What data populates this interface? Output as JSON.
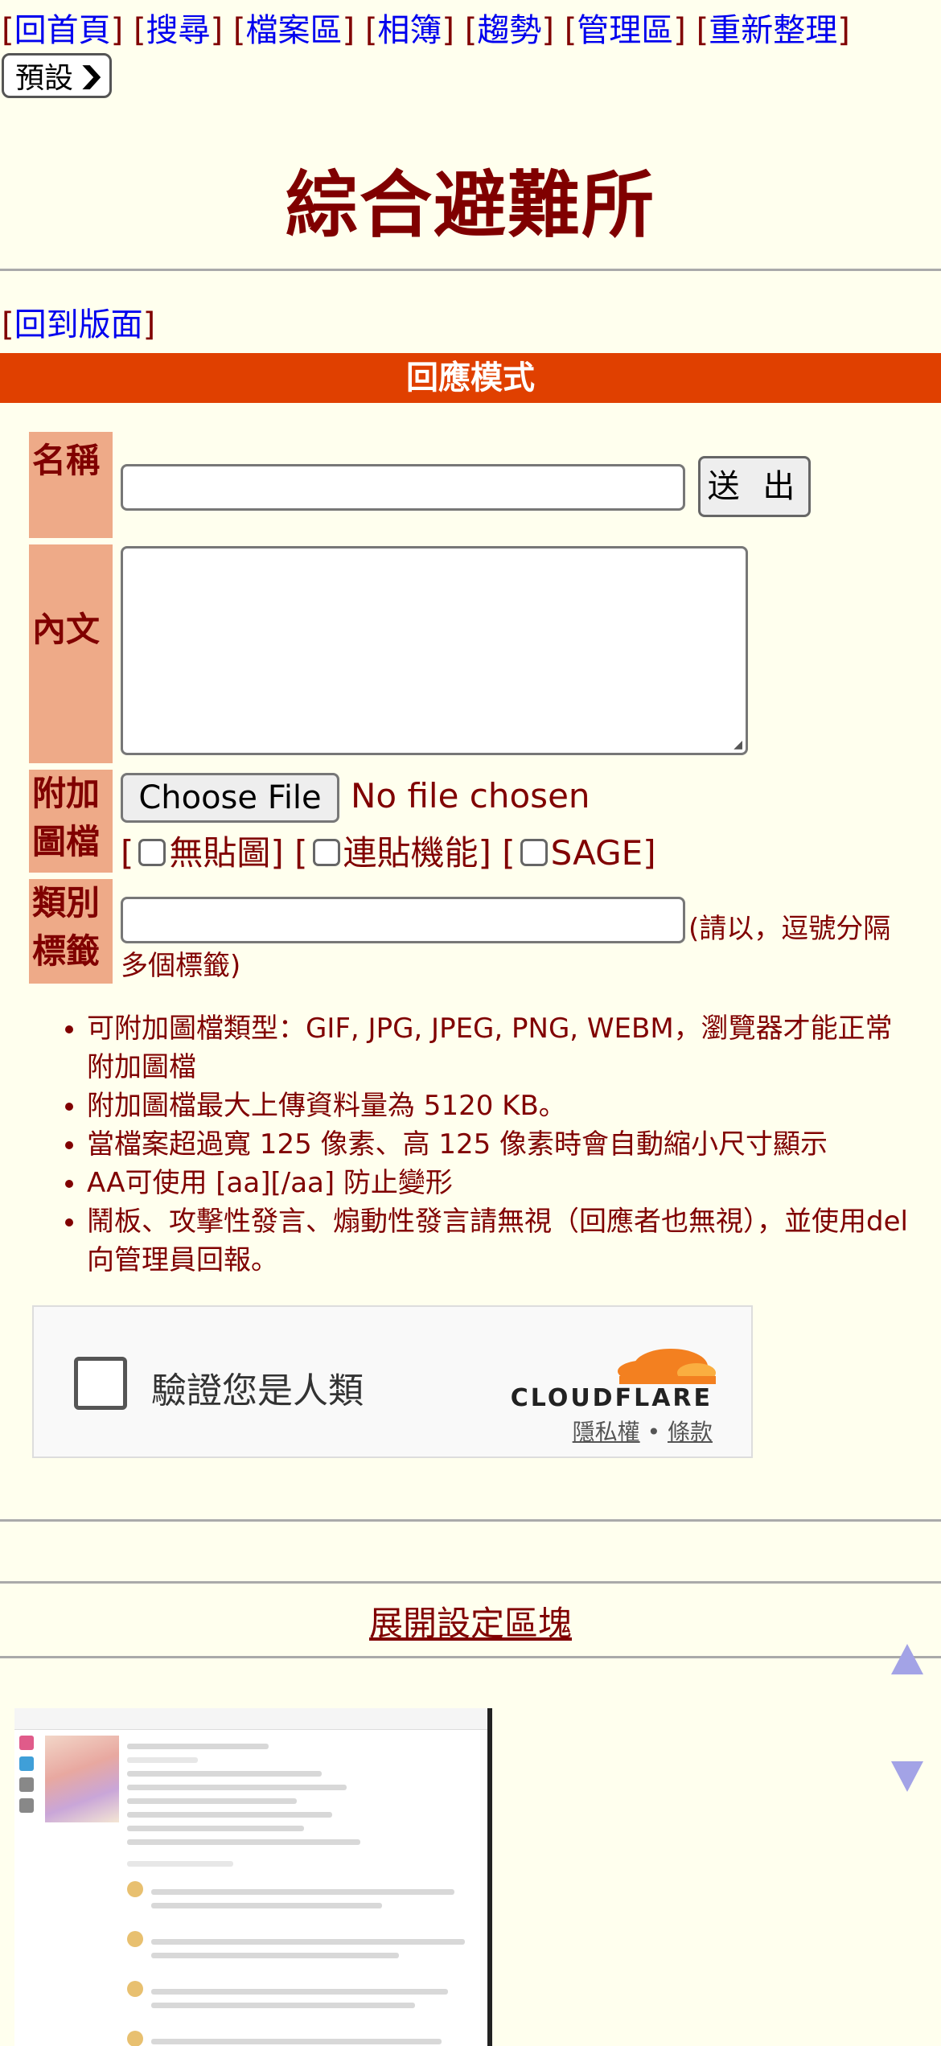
{
  "nav": {
    "links": [
      "回首頁",
      "搜尋",
      "檔案區",
      "相簿",
      "趨勢",
      "管理區",
      "重新整理"
    ],
    "style_select": "預設"
  },
  "board": {
    "title": "綜合避難所",
    "back_link": "回到版面",
    "mode_label": "回應模式"
  },
  "form": {
    "name_label": "名稱",
    "submit_label": "送 出",
    "body_label": "內文",
    "file_label": "附加圖檔",
    "choose_file_label": "Choose File",
    "no_file_text": "No file chosen",
    "options": [
      "無貼圖",
      "連貼機能",
      "SAGE"
    ],
    "category_label": "類別標籤",
    "category_hint_1": "(請以，逗號分隔",
    "category_hint_2": "多個標籤)"
  },
  "notes": [
    "可附加圖檔類型：GIF, JPG, JPEG, PNG, WEBM，瀏覽器才能正常附加圖檔",
    "附加圖檔最大上傳資料量為 5120 KB。",
    "當檔案超過寬 125 像素、高 125 像素時會自動縮小尺寸顯示",
    "AA可使用 [aa][/aa] 防止變形",
    "鬧板、攻擊性發言、煽動性發言請無視（回應者也無視），並使用del向管理員回報。"
  ],
  "captcha": {
    "label": "驗證您是人類",
    "brand": "CLOUDFLARE",
    "privacy": "隱私權",
    "separator": "•",
    "terms": "條款"
  },
  "settings": {
    "expand_label": "展開設定區塊"
  },
  "colors": {
    "background": "#FFFFEE",
    "text": "#800000",
    "link": "#0000EE",
    "mode_bar": "#E04000",
    "label_cell": "#EEAA88",
    "scroll_arrows": "#A3A3E6"
  }
}
